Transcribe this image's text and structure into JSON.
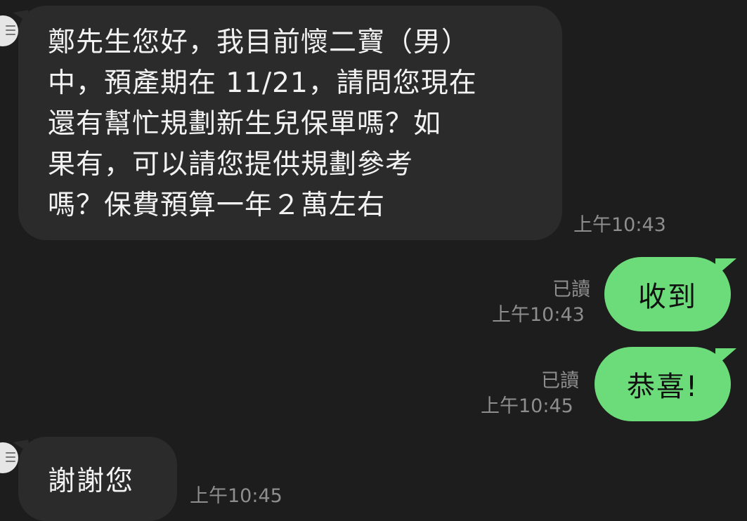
{
  "chat": {
    "messages": [
      {
        "side": "incoming",
        "text": "鄭先生您好，我目前懷二寶（男）\n中，預產期在 11/21，請問您現在\n還有幫忙規劃新生兒保單嗎？如\n果有，可以請您提供規劃參考\n嗎？保費預算一年２萬左右",
        "time": "上午10:43"
      },
      {
        "side": "outgoing",
        "text": "收到",
        "status": "已讀",
        "time": "上午10:43"
      },
      {
        "side": "outgoing",
        "text": "恭喜!",
        "status": "已讀",
        "time": "上午10:45"
      },
      {
        "side": "incoming",
        "text": "謝謝您",
        "time": "上午10:45"
      }
    ]
  },
  "colors": {
    "background": "#1d1d1d",
    "incoming_bubble": "#2b2b2b",
    "outgoing_bubble": "#6bdc79",
    "meta_text": "#8e8e8e"
  },
  "icons": {
    "avatar": "contact-avatar-icon"
  }
}
